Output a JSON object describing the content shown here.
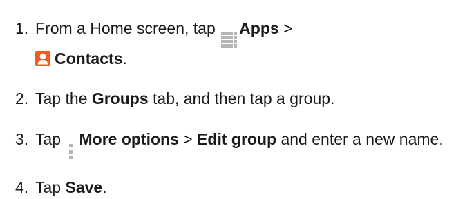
{
  "steps": [
    {
      "number": "1.",
      "parts": {
        "t1": "From a Home screen, tap ",
        "apps": "Apps",
        "sep": " >",
        "contacts": "Contacts",
        "end": "."
      },
      "icons": [
        "apps-grid-icon",
        "contacts-icon"
      ]
    },
    {
      "number": "2.",
      "parts": {
        "t1": "Tap the ",
        "groups": "Groups",
        "t2": " tab, and then tap a group."
      }
    },
    {
      "number": "3.",
      "parts": {
        "t1": "Tap ",
        "more": "More options",
        "sep": " > ",
        "edit": "Edit group",
        "t2": " and enter a new name."
      },
      "icons": [
        "more-options-icon"
      ]
    },
    {
      "number": "4.",
      "parts": {
        "t1": "Tap ",
        "save": "Save",
        "end": "."
      }
    }
  ],
  "colors": {
    "text": "#1a1a1a",
    "icon_gray": "#b5b5b5",
    "contacts_orange": "#f15a22"
  }
}
